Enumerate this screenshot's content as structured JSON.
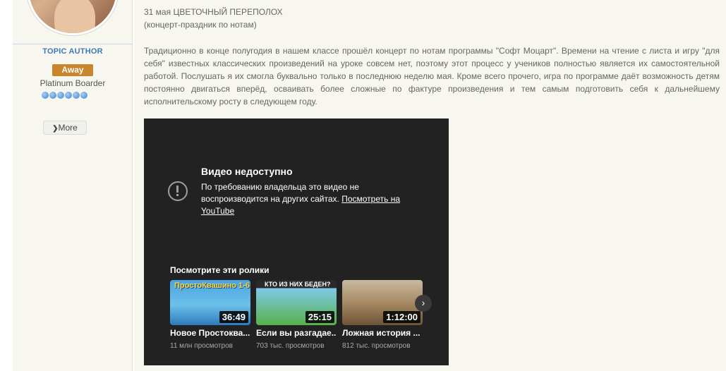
{
  "author": {
    "role_label": "TOPIC AUTHOR",
    "status": "Away",
    "rank": "Platinum Boarder",
    "rank_level": 6,
    "more_label": "More"
  },
  "post": {
    "date_title": "31 мая ЦВЕТОЧНЫЙ ПЕРЕПОЛОХ",
    "subtitle": "(концерт-праздник по нотам)",
    "body": "Традиционно в конце полугодия в нашем классе прошёл концерт по нотам программы \"Софт Моцарт\". Времени на чтение с листа и игру \"для себя\" известных классических произведений на уроке совсем нет, поэтому этот процесс у учеников полностью является их самостоятельной работой. Послушать я их смогла буквально только в последнюю неделю мая. Кроме всего прочего, игра по программе даёт возможность детям постоянно двигаться вперёд, осваивать более сложные по фактуре произведения и тем самым подготовить себя к дальнейшему исполнительскому росту в следующем году."
  },
  "video": {
    "unavailable_title": "Видео недоступно",
    "unavailable_message": "По требованию владельца это видео не воспроизводится на других сайтах.",
    "unavailable_link": "Посмотреть на YouTube",
    "suggestions_title": "Посмотрите эти ролики",
    "suggestions": [
      {
        "title": "Новое Простоква...",
        "views": "11 млн просмотров",
        "duration": "36:49",
        "thumb_text": "ПростоКвашино 1-6"
      },
      {
        "title": "Если вы разгадае...",
        "views": "703 тыс. просмотров",
        "duration": "25:15",
        "thumb_text": "КТО ИЗ НИХ БЕДЕН?"
      },
      {
        "title": "Ложная история ...",
        "views": "812 тыс. просмотров",
        "duration": "1:12:00",
        "thumb_text": ""
      }
    ]
  },
  "colors": {
    "author_label": "#3e7ab8",
    "away_badge": "#c9852b",
    "video_bg": "#222222",
    "page_bg": "#f7f6ef"
  },
  "icons": [
    "warning-icon",
    "chevron-down-icon",
    "chevron-right-icon",
    "rank-dot-icon"
  ]
}
